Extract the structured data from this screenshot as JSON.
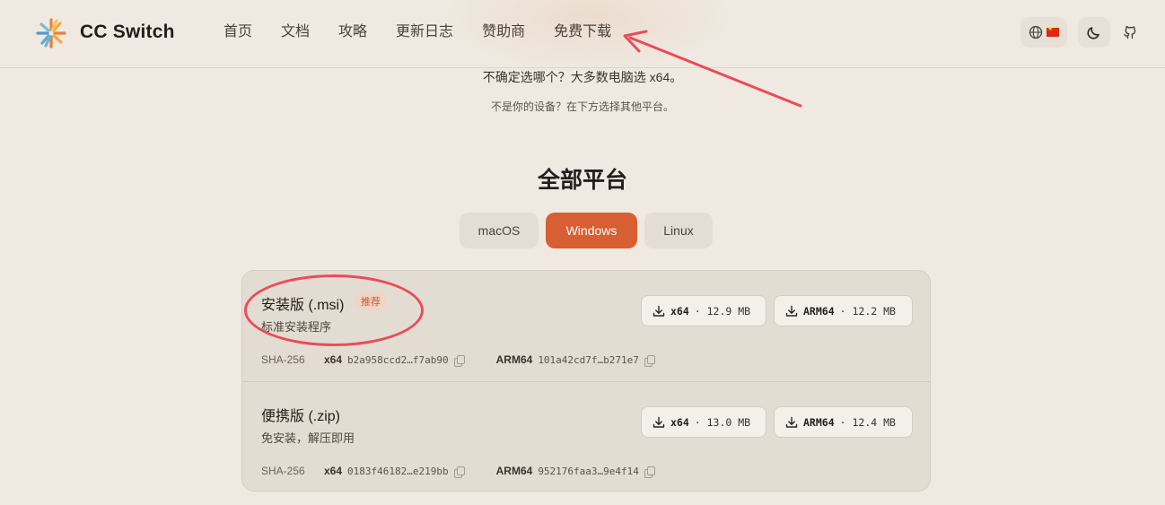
{
  "header": {
    "brand": "CC Switch",
    "logo_icon": "sunburst-logo",
    "nav": [
      "首页",
      "文档",
      "攻略",
      "更新日志",
      "赞助商",
      "免费下载"
    ],
    "lang_icon": "globe-icon",
    "theme_icon": "moon-icon",
    "github_icon": "github-icon"
  },
  "hints": {
    "line1": "不确定选哪个？大多数电脑选 x64。",
    "line2": "不是你的设备？在下方选择其他平台。"
  },
  "section_title": "全部平台",
  "tabs": [
    {
      "label": "macOS",
      "active": false
    },
    {
      "label": "Windows",
      "active": true
    },
    {
      "label": "Linux",
      "active": false
    }
  ],
  "accent_color": "#d85f33",
  "annotation_color": "#ea4c58",
  "packages": [
    {
      "title": "安装版 (.msi)",
      "badge": "推荐",
      "subtitle": "标准安装程序",
      "downloads": [
        {
          "arch": "x64",
          "size": "· 12.9 MB"
        },
        {
          "arch": "ARM64",
          "size": "· 12.2 MB"
        }
      ],
      "sha_label": "SHA-256",
      "hashes": [
        {
          "arch": "x64",
          "hash": "b2a958ccd2…f7ab90"
        },
        {
          "arch": "ARM64",
          "hash": "101a42cd7f…b271e7"
        }
      ]
    },
    {
      "title": "便携版 (.zip)",
      "badge": "",
      "subtitle": "免安装，解压即用",
      "downloads": [
        {
          "arch": "x64",
          "size": "· 13.0 MB"
        },
        {
          "arch": "ARM64",
          "size": "· 12.4 MB"
        }
      ],
      "sha_label": "SHA-256",
      "hashes": [
        {
          "arch": "x64",
          "hash": "0183f46182…e219bb"
        },
        {
          "arch": "ARM64",
          "hash": "952176faa3…9e4f14"
        }
      ]
    }
  ]
}
